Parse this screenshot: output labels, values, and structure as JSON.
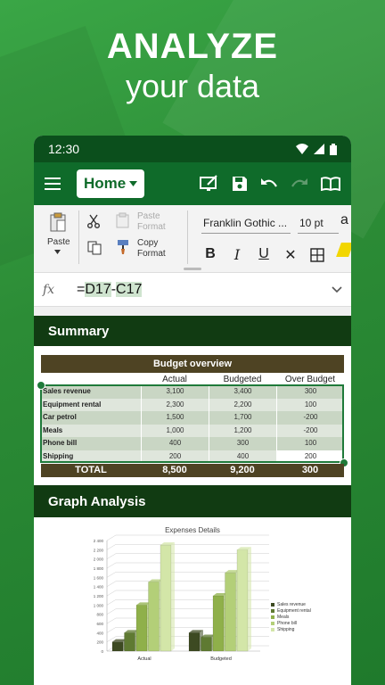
{
  "hero": {
    "line1": "ANALYZE",
    "line2": "your data"
  },
  "status": {
    "time": "12:30"
  },
  "toolbar": {
    "home_label": "Home"
  },
  "ribbon": {
    "paste": "Paste",
    "paste_format_l1": "Paste",
    "paste_format_l2": "Format",
    "copy_format_l1": "Copy",
    "copy_format_l2": "Format",
    "font": "Franklin Gothic ...",
    "size": "10 pt"
  },
  "formula": {
    "prefix": "=",
    "ref1": "D17",
    "op": "-",
    "ref2": "C17"
  },
  "sections": {
    "summary": "Summary",
    "graph": "Graph Analysis"
  },
  "budget": {
    "title": "Budget overview",
    "columns": [
      "Actual",
      "Budgeted",
      "Over Budget"
    ],
    "rows": [
      [
        "Sales revenue",
        "3,100",
        "3,400",
        "300"
      ],
      [
        "Equipment rental",
        "2,300",
        "2,200",
        "100"
      ],
      [
        "Car petrol",
        "1,500",
        "1,700",
        "-200"
      ],
      [
        "Meals",
        "1,000",
        "1,200",
        "-200"
      ],
      [
        "Phone bill",
        "400",
        "300",
        "100"
      ],
      [
        "Shipping",
        "200",
        "400",
        "200"
      ]
    ],
    "total": [
      "TOTAL",
      "8,500",
      "9,200",
      "300"
    ]
  },
  "chart_data": {
    "type": "bar",
    "title": "Expenses Details",
    "categories": [
      "Actual",
      "Budgeted"
    ],
    "series": [
      {
        "name": "Sales revenue",
        "values": [
          200,
          400
        ]
      },
      {
        "name": "Equipment rental",
        "values": [
          400,
          300
        ]
      },
      {
        "name": "Meals",
        "values": [
          1000,
          1200
        ]
      },
      {
        "name": "Phone bill",
        "values": [
          1500,
          1700
        ]
      },
      {
        "name": "Shipping",
        "values": [
          2300,
          2200
        ]
      }
    ],
    "ylim": [
      0,
      2400
    ],
    "yticks": [
      "0",
      "200",
      "400",
      "600",
      "800",
      "1 000",
      "1 200",
      "1 400",
      "1 600",
      "1 800",
      "2 000",
      "2 200",
      "2 400"
    ],
    "colors": [
      "#3d4a22",
      "#5f7a32",
      "#8fb04a",
      "#b3cf78",
      "#d3e6a8"
    ],
    "legend": "right"
  }
}
